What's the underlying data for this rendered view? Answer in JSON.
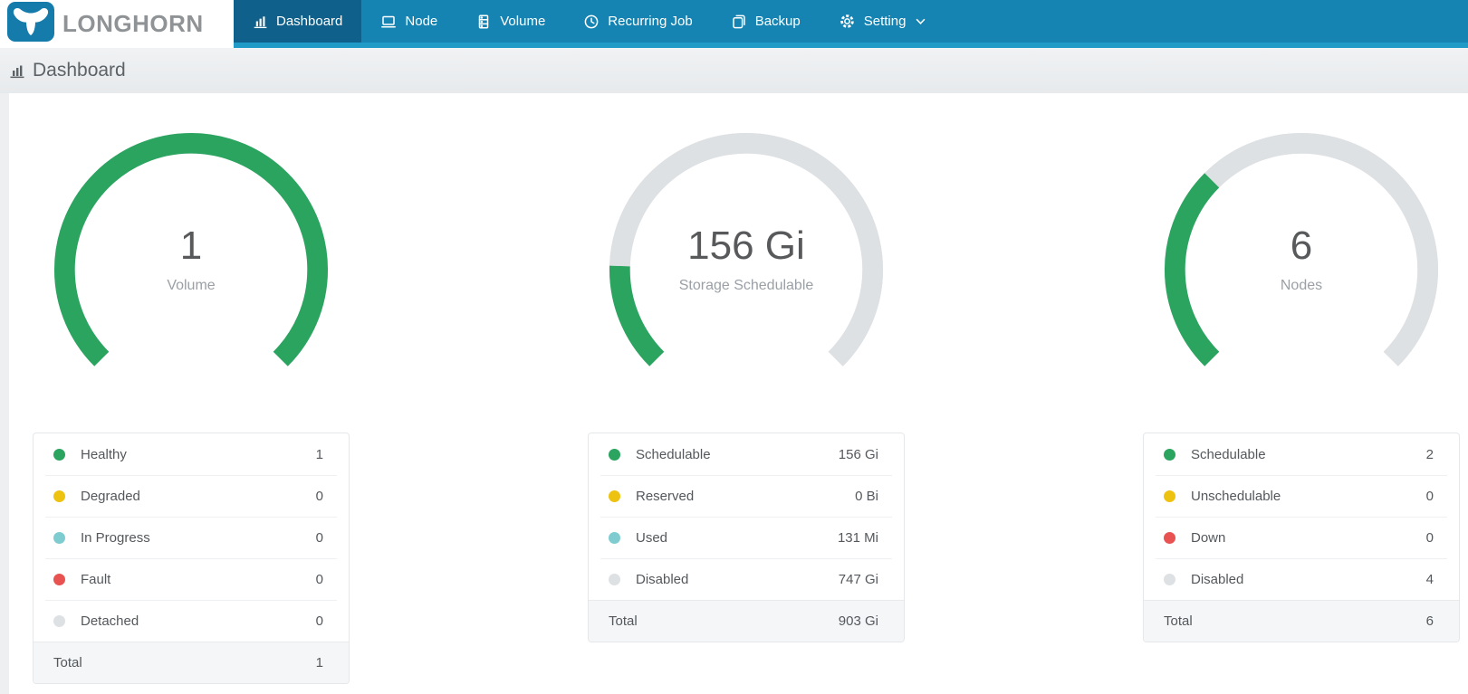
{
  "brand": {
    "name": "LONGHORN"
  },
  "nav": {
    "items": [
      {
        "label": "Dashboard",
        "icon": "dashboard-icon",
        "active": true
      },
      {
        "label": "Node",
        "icon": "node-icon",
        "active": false
      },
      {
        "label": "Volume",
        "icon": "volume-icon",
        "active": false
      },
      {
        "label": "Recurring Job",
        "icon": "recurring-job-icon",
        "active": false
      },
      {
        "label": "Backup",
        "icon": "backup-icon",
        "active": false
      },
      {
        "label": "Setting",
        "icon": "setting-icon",
        "active": false,
        "has_chevron": true
      }
    ]
  },
  "breadcrumb": {
    "title": "Dashboard"
  },
  "colors": {
    "nav_blue": "#1584b2",
    "nav_strip": "#209bc7",
    "active_tab": "#0f618b",
    "logo_blue": "#147bab",
    "healthy_green": "#2aa45f",
    "warning_yellow": "#eec211",
    "progress_teal": "#7fccd0",
    "fault_red": "#e85352",
    "disabled_gray": "#dee1e3",
    "gauge_track": "#dde0e2"
  },
  "chart_data": [
    {
      "type": "gauge",
      "center_value": "1",
      "center_label": "Volume",
      "start_angle_deg": 225,
      "arc_span_deg": 270,
      "total_num": 1,
      "track_color": "#dde0e2",
      "legend": [
        {
          "label": "Healthy",
          "display": "1",
          "num": 1,
          "color": "#2aa45f"
        },
        {
          "label": "Degraded",
          "display": "0",
          "num": 0,
          "color": "#eec211"
        },
        {
          "label": "In Progress",
          "display": "0",
          "num": 0,
          "color": "#7fccd0"
        },
        {
          "label": "Fault",
          "display": "0",
          "num": 0,
          "color": "#e85352"
        },
        {
          "label": "Detached",
          "display": "0",
          "num": 0,
          "color": "#dee1e3"
        }
      ],
      "total_label": "Total",
      "total_display": "1"
    },
    {
      "type": "gauge",
      "center_value": "156 Gi",
      "center_label": "Storage Schedulable",
      "start_angle_deg": 225,
      "arc_span_deg": 270,
      "total_num": 903,
      "track_color": "#dde0e2",
      "legend": [
        {
          "label": "Schedulable",
          "display": "156 Gi",
          "num": 156,
          "color": "#2aa45f"
        },
        {
          "label": "Reserved",
          "display": "0 Bi",
          "num": 0,
          "color": "#eec211"
        },
        {
          "label": "Used",
          "display": "131 Mi",
          "num": 0.128,
          "color": "#7fccd0"
        },
        {
          "label": "Disabled",
          "display": "747 Gi",
          "num": 747,
          "color": "#dee1e3"
        }
      ],
      "total_label": "Total",
      "total_display": "903 Gi"
    },
    {
      "type": "gauge",
      "center_value": "6",
      "center_label": "Nodes",
      "start_angle_deg": 225,
      "arc_span_deg": 270,
      "total_num": 6,
      "track_color": "#dde0e2",
      "legend": [
        {
          "label": "Schedulable",
          "display": "2",
          "num": 2,
          "color": "#2aa45f"
        },
        {
          "label": "Unschedulable",
          "display": "0",
          "num": 0,
          "color": "#eec211"
        },
        {
          "label": "Down",
          "display": "0",
          "num": 0,
          "color": "#e85352"
        },
        {
          "label": "Disabled",
          "display": "4",
          "num": 4,
          "color": "#dee1e3"
        }
      ],
      "total_label": "Total",
      "total_display": "6"
    }
  ]
}
